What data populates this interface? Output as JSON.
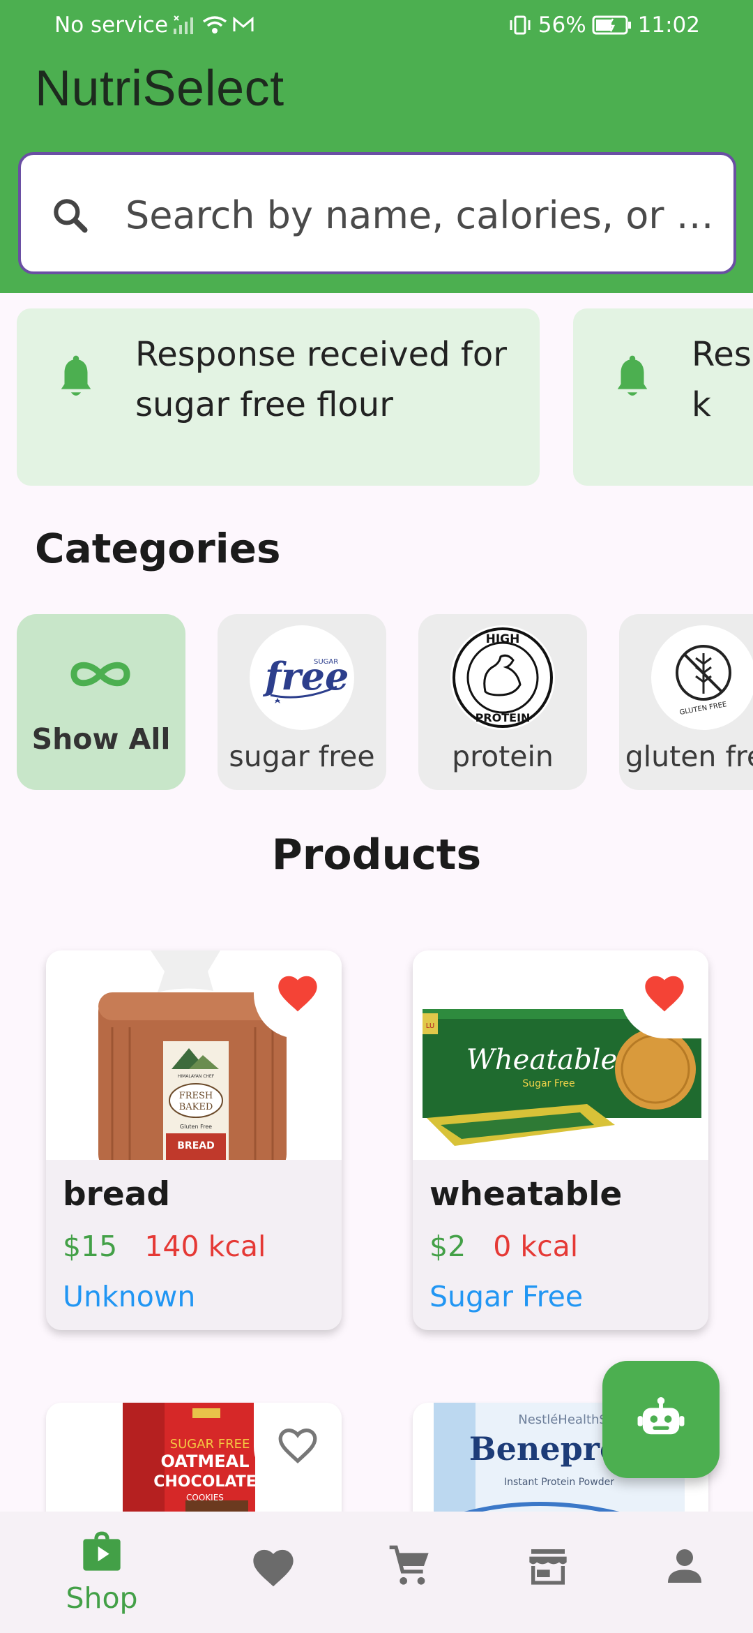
{
  "status_bar": {
    "carrier": "No service",
    "battery": "56%",
    "time": "11:02"
  },
  "app": {
    "title": "NutriSelect"
  },
  "search": {
    "placeholder": "Search by name, calories, or …"
  },
  "notifications": [
    {
      "text": "Response received for sugar free flour",
      "icon": "bell-icon"
    },
    {
      "text": "Response received for k",
      "icon": "bell-icon"
    }
  ],
  "categories": {
    "title": "Categories",
    "items": [
      {
        "label": "Show All",
        "icon": "infinity-icon",
        "active": true
      },
      {
        "label": "sugar free",
        "icon": "sugar-free-logo"
      },
      {
        "label": "protein",
        "icon": "high-protein-logo"
      },
      {
        "label": "gluten free",
        "icon": "gluten-free-logo"
      }
    ],
    "logo_text": {
      "sugar_free_top": "SUGAR",
      "sugar_free_main": "free",
      "protein_top": "HIGH",
      "protein_bottom": "PROTEIN",
      "gluten": "GLUTEN FREE"
    }
  },
  "products": {
    "title": "Products",
    "items": [
      {
        "name": "bread",
        "price": "$15",
        "kcal": "140 kcal",
        "tag": "Unknown",
        "favorite": true,
        "image": "bread-image",
        "image_text": {
          "brand": "HIMALAYAN CHEF",
          "line1": "FRESH",
          "line2": "BAKED",
          "line3": "Gluten Free",
          "line4": "BREAD"
        }
      },
      {
        "name": "wheatable",
        "price": "$2",
        "kcal": "0 kcal",
        "tag": "Sugar Free",
        "favorite": true,
        "image": "wheatable-image",
        "image_text": {
          "brand": "Wheatable",
          "sub": "Sugar Free",
          "badge": "LU"
        }
      },
      {
        "name": "",
        "favorite": false,
        "image": "oatmeal-cookies-image",
        "image_text": {
          "line1": "SUGAR FREE",
          "line2": "OATMEAL",
          "line3": "CHOCOLATE",
          "line4": "COOKIES"
        }
      },
      {
        "name": "",
        "favorite": true,
        "image": "beneprotein-image",
        "image_text": {
          "brand": "NestléHealthSc",
          "main": "Beneprote",
          "sub": "Instant Protein Powder"
        }
      }
    ]
  },
  "fab": {
    "icon": "robot-icon"
  },
  "bottom_nav": {
    "items": [
      {
        "label": "Shop",
        "icon": "shop-bag-icon",
        "active": true
      },
      {
        "label": "",
        "icon": "heart-icon"
      },
      {
        "label": "",
        "icon": "cart-icon"
      },
      {
        "label": "",
        "icon": "store-icon"
      },
      {
        "label": "",
        "icon": "person-icon"
      }
    ]
  },
  "colors": {
    "primary": "#4caf50",
    "favorite": "#f44336",
    "price": "#43a047",
    "kcal": "#e53935",
    "tag": "#2196f3"
  }
}
